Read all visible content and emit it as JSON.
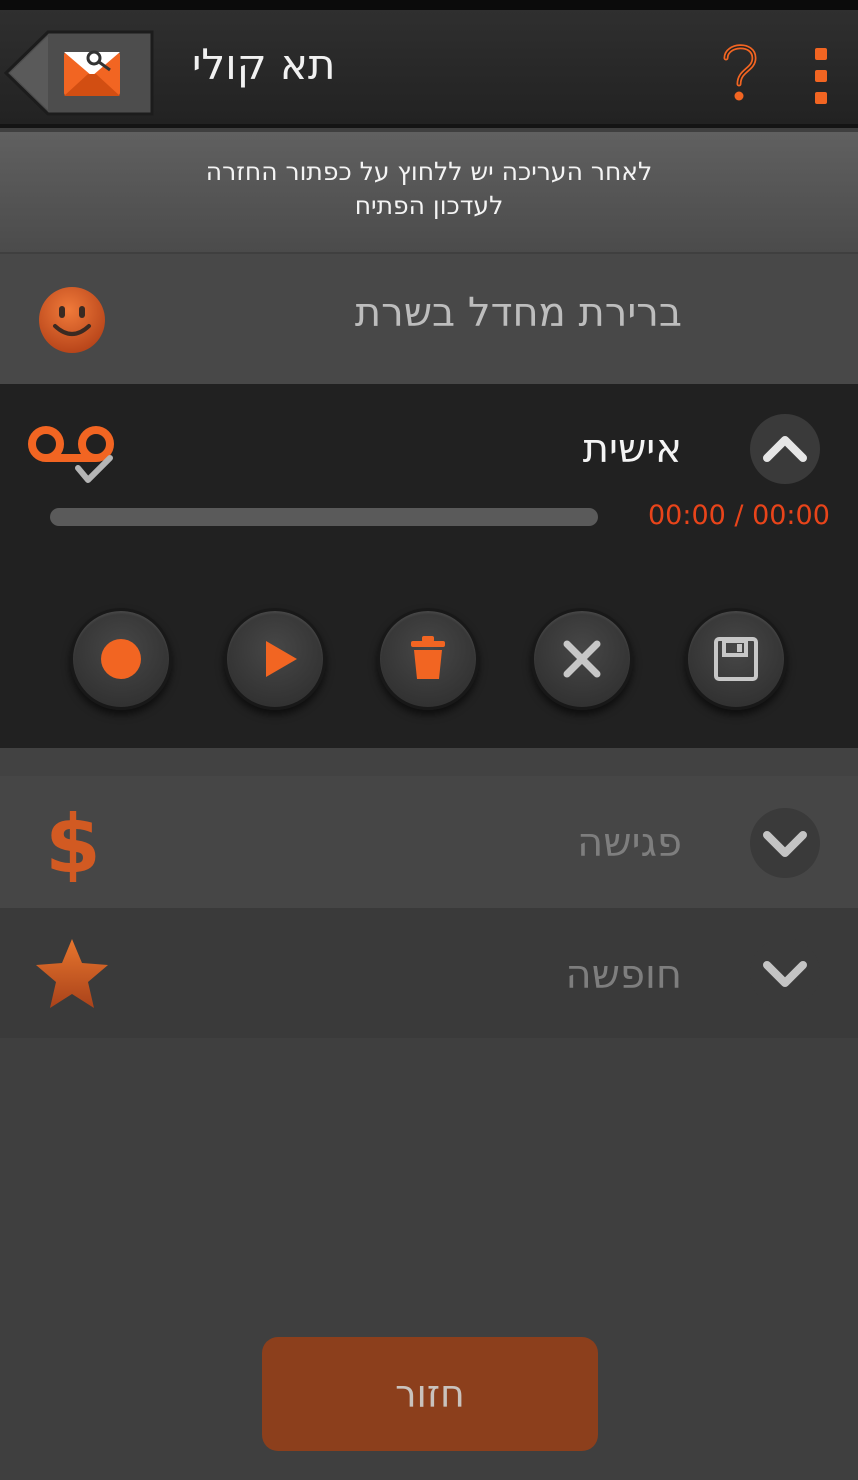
{
  "header": {
    "title": "תא קולי",
    "back_icon": "mail-key-icon",
    "help_icon": "question-mark-icon",
    "menu_icon": "overflow-dots-icon",
    "accent_color": "#f26522"
  },
  "info_banner": {
    "line1": "לאחר העריכה יש ללחוץ על כפתור החזרה",
    "line2": "לעדכון הפתיח"
  },
  "greetings": [
    {
      "label": "ברירת מחדל בשרת",
      "icon": "smiley-face-icon",
      "state": "default"
    },
    {
      "label": "אישית",
      "icon": "voicemail-check-icon",
      "state": "expanded",
      "timer": "00:00 / 00:00",
      "progress": 0,
      "controls": [
        "record-icon",
        "play-icon",
        "trash-icon",
        "cancel-icon",
        "save-icon"
      ]
    },
    {
      "label": "פגישה",
      "icon": "dollar-icon",
      "state": "collapsed"
    },
    {
      "label": "חופשה",
      "icon": "star-icon",
      "state": "collapsed"
    }
  ],
  "footer": {
    "return_label": "חזור"
  }
}
